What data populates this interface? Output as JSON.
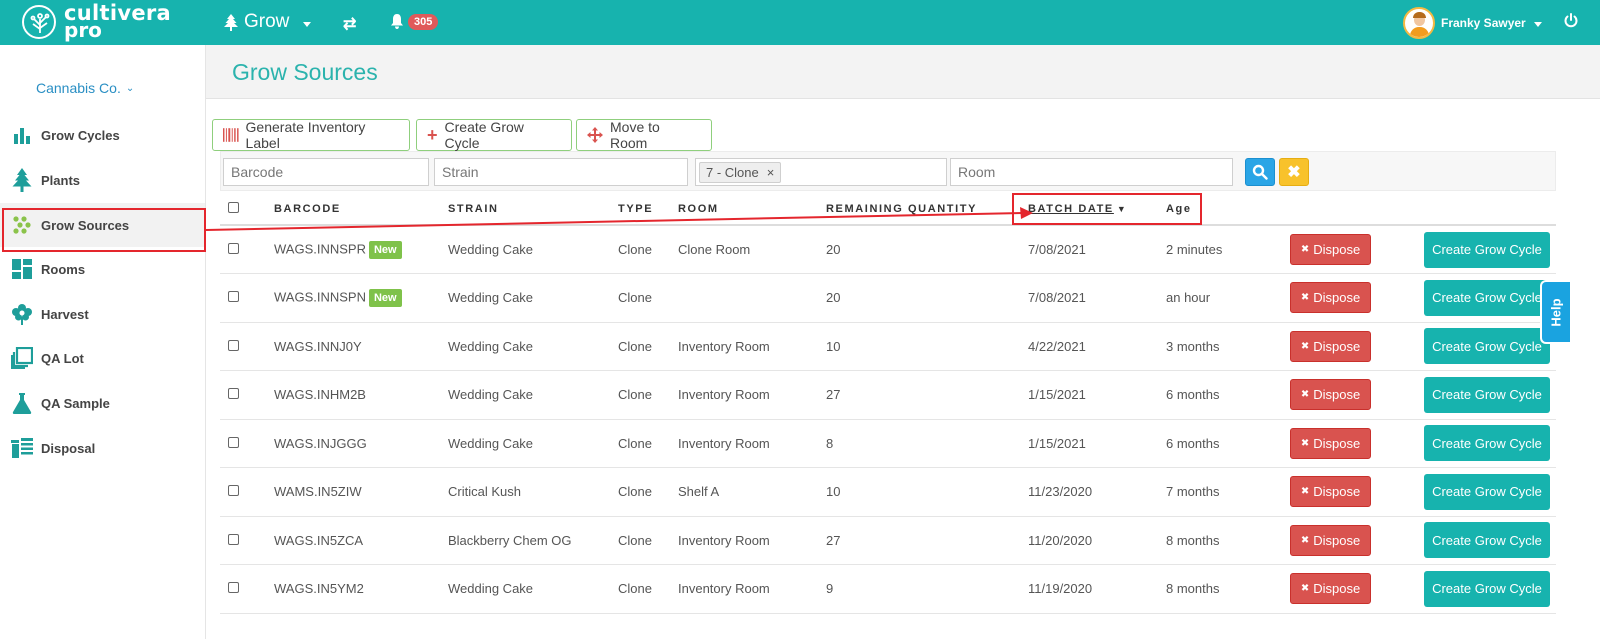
{
  "brand": {
    "line1": "cultivera",
    "line2": "pro"
  },
  "topbar": {
    "module": "Grow",
    "notifications": "305",
    "user_name": "Franky Sawyer"
  },
  "sidebar": {
    "company": "Cannabis Co.",
    "items": [
      {
        "label": "Grow Cycles",
        "icon": "bar-chart-icon"
      },
      {
        "label": "Plants",
        "icon": "tree-icon"
      },
      {
        "label": "Grow Sources",
        "icon": "dots-icon"
      },
      {
        "label": "Rooms",
        "icon": "grid-icon"
      },
      {
        "label": "Harvest",
        "icon": "flower-icon"
      },
      {
        "label": "QA Lot",
        "icon": "layers-icon"
      },
      {
        "label": "QA Sample",
        "icon": "flask-icon"
      },
      {
        "label": "Disposal",
        "icon": "bin-icon"
      }
    ]
  },
  "page": {
    "title": "Grow Sources"
  },
  "toolbar": {
    "generate_label": "Generate Inventory Label",
    "create_label": "Create Grow Cycle",
    "move_label": "Move to Room"
  },
  "filters": {
    "barcode_placeholder": "Barcode",
    "strain_placeholder": "Strain",
    "type_tag": "7 - Clone",
    "room_placeholder": "Room"
  },
  "table": {
    "headers": {
      "barcode": "BARCODE",
      "strain": "STRAIN",
      "type": "TYPE",
      "room": "ROOM",
      "remaining": "REMAINING QUANTITY",
      "batch_date": "BATCH DATE",
      "age": "Age"
    },
    "new_badge": "New",
    "dispose_label": "Dispose",
    "create_label": "Create Grow Cycle",
    "rows": [
      {
        "barcode": "WAGS.INNSPR",
        "is_new": true,
        "strain": "Wedding Cake",
        "type": "Clone",
        "room": "Clone Room",
        "qty": "20",
        "date": "7/08/2021",
        "age": "2 minutes"
      },
      {
        "barcode": "WAGS.INNSPN",
        "is_new": true,
        "strain": "Wedding Cake",
        "type": "Clone",
        "room": "",
        "qty": "20",
        "date": "7/08/2021",
        "age": "an hour"
      },
      {
        "barcode": "WAGS.INNJ0Y",
        "is_new": false,
        "strain": "Wedding Cake",
        "type": "Clone",
        "room": "Inventory Room",
        "qty": "10",
        "date": "4/22/2021",
        "age": "3 months"
      },
      {
        "barcode": "WAGS.INHM2B",
        "is_new": false,
        "strain": "Wedding Cake",
        "type": "Clone",
        "room": "Inventory Room",
        "qty": "27",
        "date": "1/15/2021",
        "age": "6 months"
      },
      {
        "barcode": "WAGS.INJGGG",
        "is_new": false,
        "strain": "Wedding Cake",
        "type": "Clone",
        "room": "Inventory Room",
        "qty": "8",
        "date": "1/15/2021",
        "age": "6 months"
      },
      {
        "barcode": "WAMS.IN5ZIW",
        "is_new": false,
        "strain": "Critical Kush",
        "type": "Clone",
        "room": "Shelf A",
        "qty": "10",
        "date": "11/23/2020",
        "age": "7 months"
      },
      {
        "barcode": "WAGS.IN5ZCA",
        "is_new": false,
        "strain": "Blackberry Chem OG",
        "type": "Clone",
        "room": "Inventory Room",
        "qty": "27",
        "date": "11/20/2020",
        "age": "8 months"
      },
      {
        "barcode": "WAGS.IN5YM2",
        "is_new": false,
        "strain": "Wedding Cake",
        "type": "Clone",
        "room": "Inventory Room",
        "qty": "9",
        "date": "11/19/2020",
        "age": "8 months"
      }
    ]
  },
  "help": {
    "label": "Help"
  },
  "colors": {
    "teal": "#17b3ae",
    "danger": "#d9534f",
    "new": "#7fc24a",
    "highlight": "#e4262d"
  }
}
